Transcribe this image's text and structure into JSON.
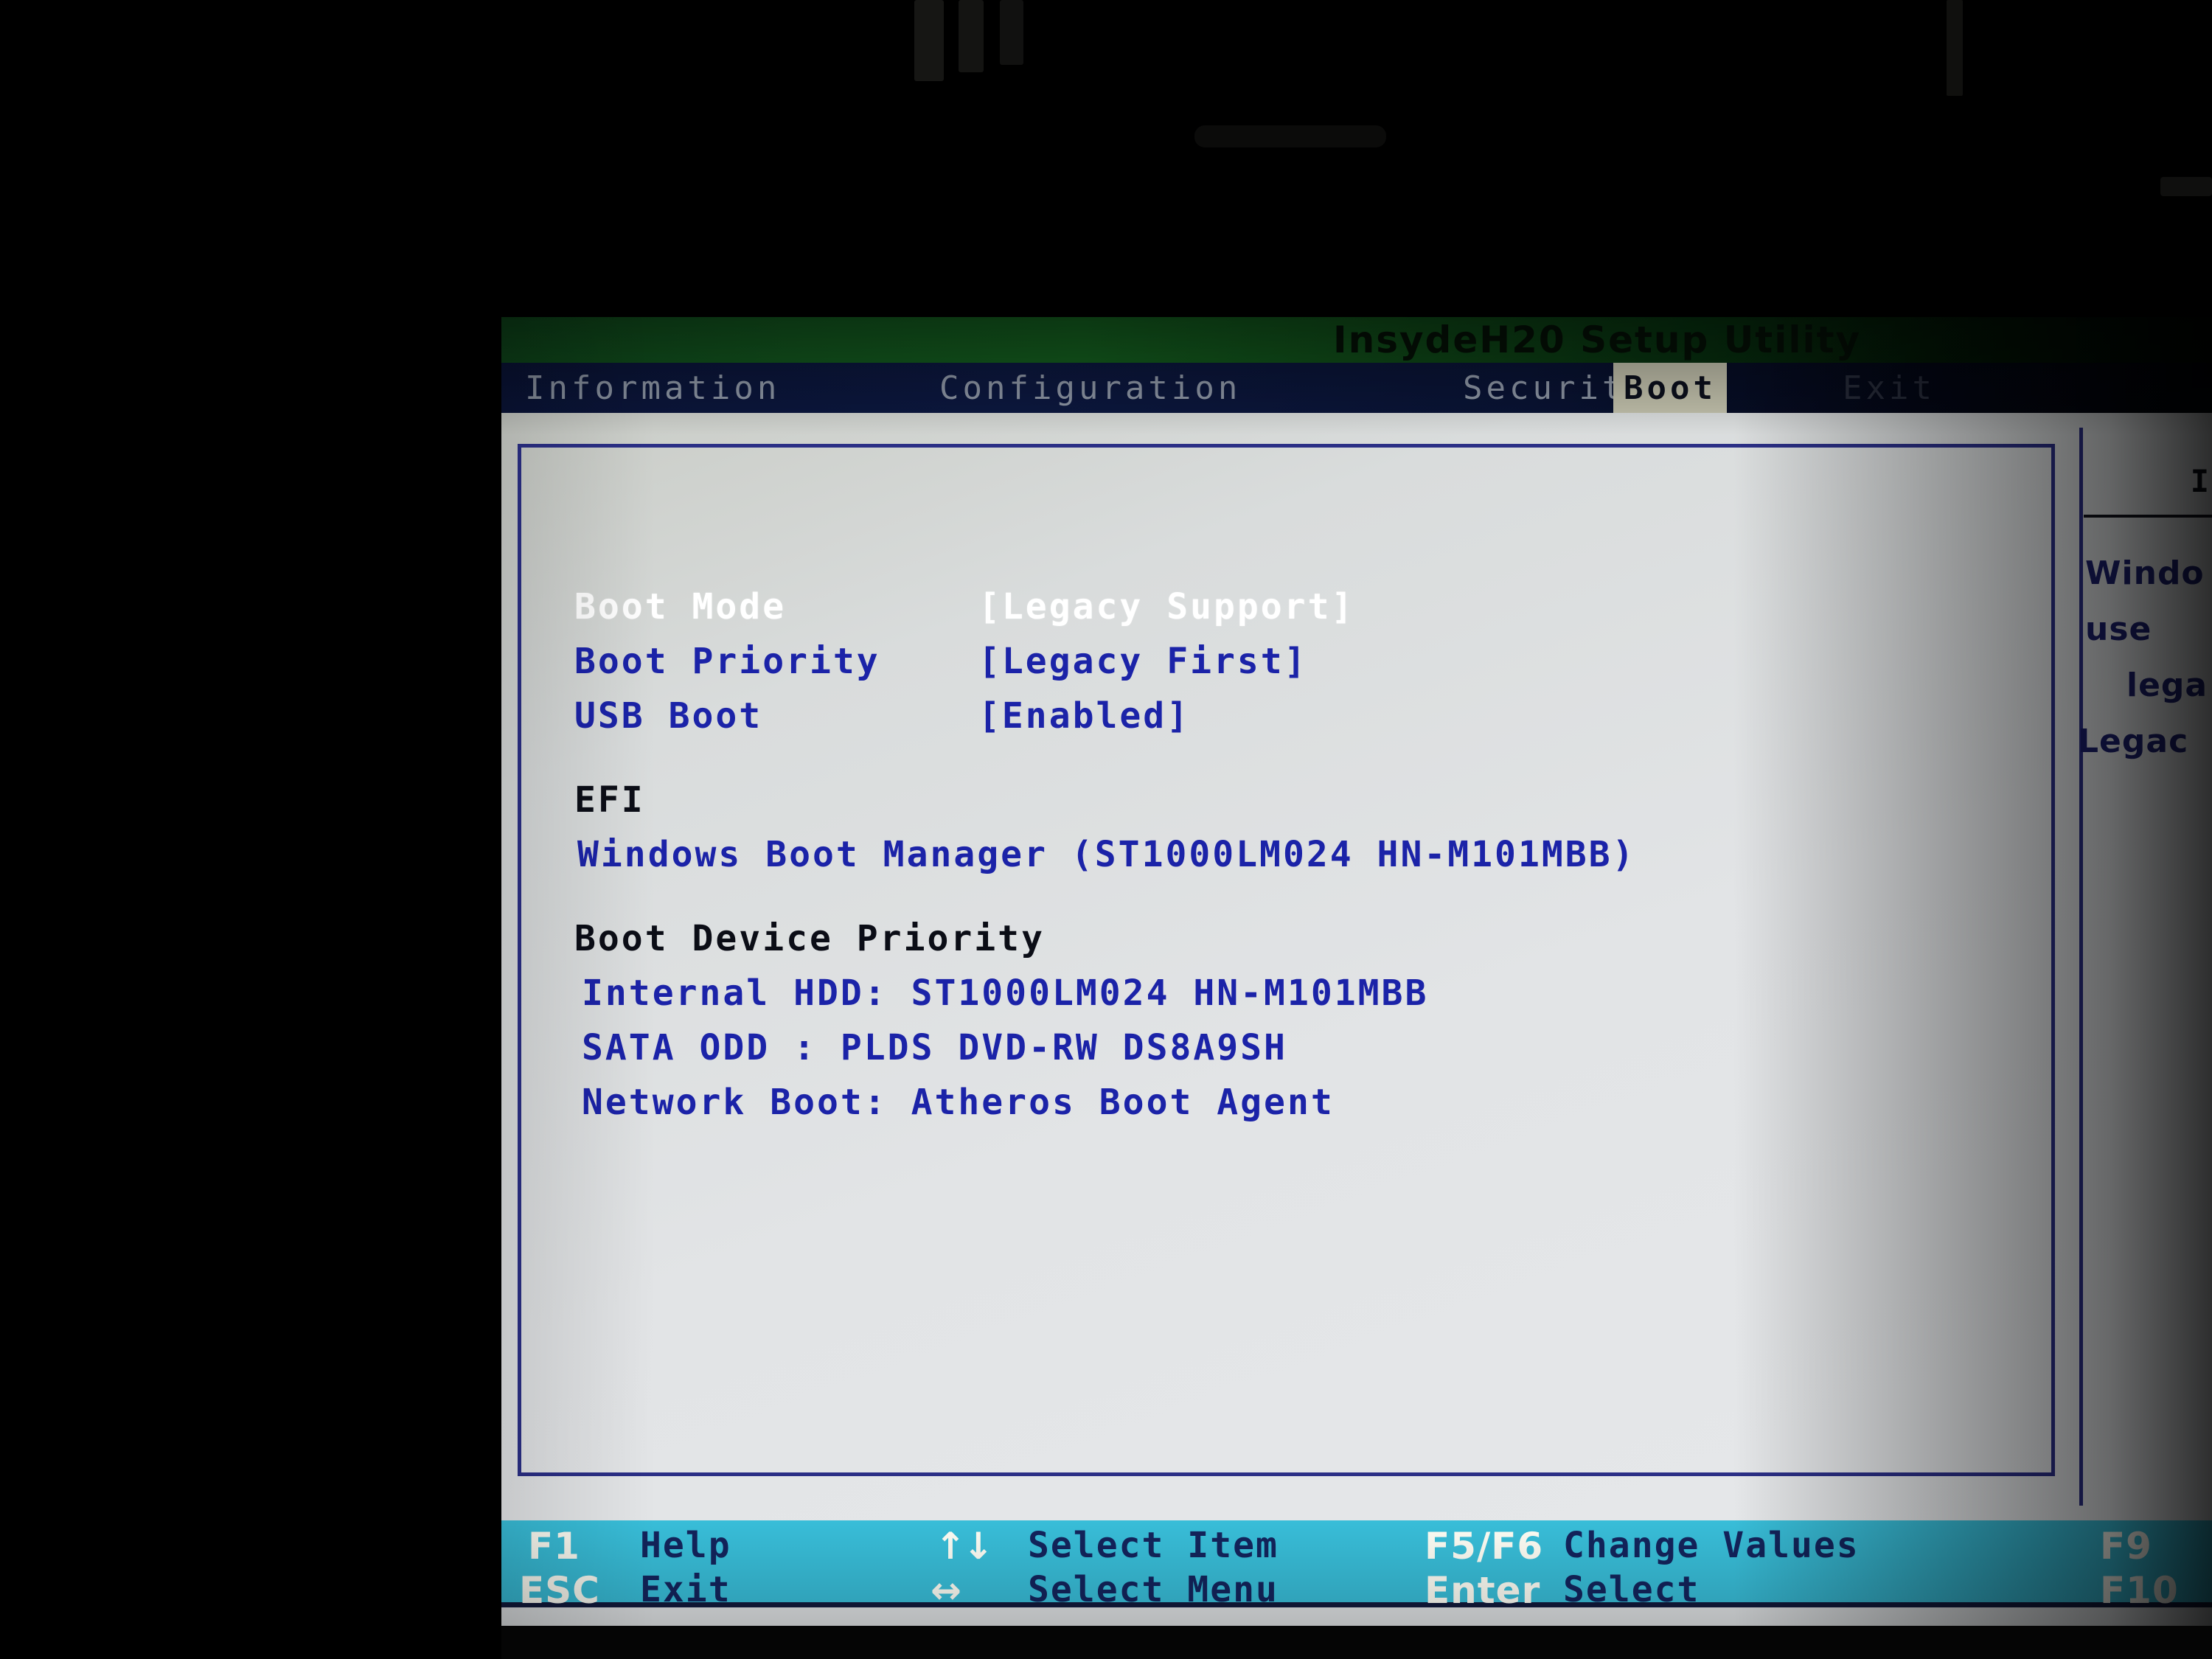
{
  "window": {
    "app_title": "InsydeH20 Setup Utility"
  },
  "menu": {
    "tabs": [
      {
        "id": "information",
        "label": "Information",
        "active": false
      },
      {
        "id": "configuration",
        "label": "Configuration",
        "active": false
      },
      {
        "id": "security",
        "label": "Security",
        "active": false
      },
      {
        "id": "boot",
        "label": "Boot",
        "active": true
      },
      {
        "id": "exit",
        "label": "Exit",
        "active": false
      }
    ]
  },
  "main": {
    "settings": [
      {
        "label": "Boot Mode",
        "value": "[Legacy Support]",
        "selected": true
      },
      {
        "label": "Boot Priority",
        "value": "[Legacy First]",
        "selected": false
      },
      {
        "label": "USB Boot",
        "value": "[Enabled]",
        "selected": false
      }
    ],
    "efi": {
      "heading": "EFI",
      "entries": [
        "Windows Boot Manager (ST1000LM024 HN-M101MBB)"
      ]
    },
    "boot_device_priority": {
      "heading": "Boot Device Priority",
      "entries": [
        "Internal HDD: ST1000LM024 HN-M101MBB",
        "SATA ODD    : PLDS DVD-RW DS8A9SH",
        "Network Boot: Atheros Boot Agent"
      ]
    }
  },
  "help_panel": {
    "title": "I",
    "lines": [
      "Windo",
      "use ",
      "lega",
      "Legac"
    ]
  },
  "status_bar": {
    "items": [
      {
        "key": "F1",
        "desc": "Help"
      },
      {
        "key": "ESC",
        "desc": "Exit"
      },
      {
        "key": "↑↓",
        "desc": "Select Item"
      },
      {
        "key": "↔",
        "desc": "Select Menu"
      },
      {
        "key": "F5/F6",
        "desc": "Change Values"
      },
      {
        "key": "Enter",
        "desc": "Select"
      },
      {
        "key": "F9",
        "desc": ""
      },
      {
        "key": "F10",
        "desc": ""
      }
    ]
  },
  "colors": {
    "title_band_green": "#13591f",
    "menu_navy": "#0a1438",
    "active_tab_bg": "#c3c2ad",
    "body_grey": "#e2e4e6",
    "setting_blue": "#1b23a8",
    "heading_dark": "#0b0d16",
    "selected_white": "#ffffff",
    "panel_border_navy": "#2b2f86",
    "status_cyan": "#38bdd8",
    "status_desc_navy": "#13245c",
    "status_key_white": "#fdfdf4"
  }
}
